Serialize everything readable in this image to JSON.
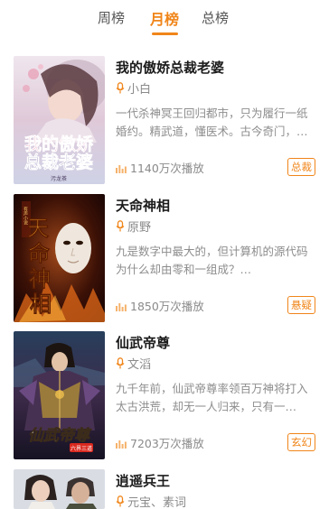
{
  "tabs": [
    {
      "label": "周榜",
      "active": false
    },
    {
      "label": "月榜",
      "active": true
    },
    {
      "label": "总榜",
      "active": false
    }
  ],
  "accent_color": "#f08519",
  "books": [
    {
      "title": "我的傲娇总裁老婆",
      "author": "小白",
      "desc_lines": [
        "一代杀神冥王回归都市，只为履行一纸",
        "婚约。精武道，懂医术。古今奇门，…"
      ],
      "plays": "1140万次播放",
      "tag": "总裁",
      "cover_text": [
        "我的傲娇",
        "总裁老婆"
      ],
      "cover_small": "污龙茶"
    },
    {
      "title": "天命神相",
      "author": "原野",
      "desc_lines": [
        "九是数字中最大的，但计算机的源代码",
        "为什么却由零和一组成？…"
      ],
      "plays": "1850万次播放",
      "tag": "悬疑",
      "cover_text": [
        "天",
        "命",
        "神",
        "相"
      ]
    },
    {
      "title": "仙武帝尊",
      "author": "文滔",
      "desc_lines": [
        "九千年前，仙武帝尊率领百万神将打入",
        "太古洪荒，却无一人归来，只有一…"
      ],
      "plays": "7203万次播放",
      "tag": "玄幻",
      "cover_text": [
        "仙武帝尊"
      ]
    },
    {
      "title": "逍遥兵王",
      "author": "元宝、素词",
      "desc_lines": [],
      "plays": "",
      "tag": ""
    }
  ]
}
